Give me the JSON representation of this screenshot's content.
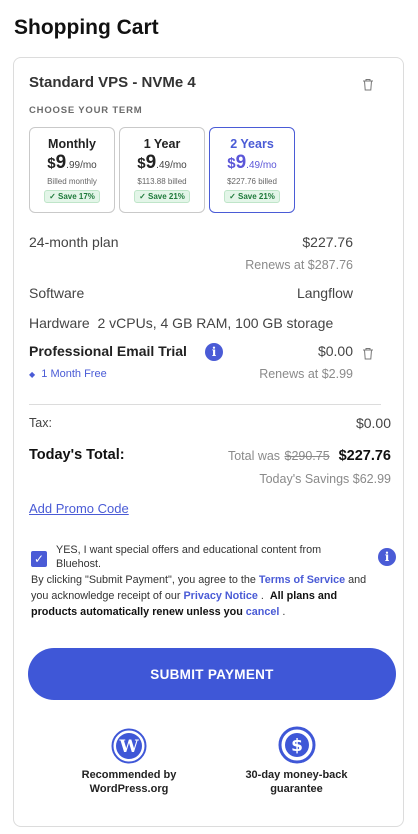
{
  "page_title": "Shopping Cart",
  "product": {
    "name": "Standard VPS - NVMe 4"
  },
  "term": {
    "label": "CHOOSE YOUR TERM",
    "options": [
      {
        "name": "Monthly",
        "currency": "$",
        "whole": "9",
        "fraction": ".99/mo",
        "billed": "Billed monthly",
        "save": "Save 17%",
        "selected": false
      },
      {
        "name": "1 Year",
        "currency": "$",
        "whole": "9",
        "fraction": ".49/mo",
        "billed": "$113.88 billed",
        "save": "Save 21%",
        "selected": false
      },
      {
        "name": "2 Years",
        "currency": "$",
        "whole": "9",
        "fraction": ".49/mo",
        "billed": "$227.76 billed",
        "save": "Save 21%",
        "selected": true
      }
    ]
  },
  "plan": {
    "label": "24-month plan",
    "price": "$227.76",
    "renews": "Renews at $287.76"
  },
  "software": {
    "label": "Software",
    "value": "Langflow"
  },
  "hardware": {
    "label": "Hardware",
    "value": "2 vCPUs, 4 GB RAM, 100 GB storage"
  },
  "email_trial": {
    "label": "Professional Email Trial",
    "price": "$0.00",
    "free_label": "1 Month Free",
    "renews": "Renews at $2.99"
  },
  "tax": {
    "label": "Tax:",
    "value": "$0.00"
  },
  "total": {
    "label": "Today's Total:",
    "was_prefix": "Total was",
    "was_value": "$290.75",
    "value": "$227.76",
    "savings": "Today's Savings $62.99"
  },
  "promo": {
    "label": "Add Promo Code"
  },
  "consent": {
    "checked": true,
    "text": "YES, I want special offers and educational content from Bluehost."
  },
  "legal": {
    "part1": "By clicking \"Submit Payment\", you agree to the",
    "terms_link": "Terms of Service",
    "part2": "and you acknowledge receipt of our",
    "privacy_link": "Privacy Notice",
    "part3": ".",
    "bold1": "All plans and products automatically renew unless you",
    "cancel_link": "cancel",
    "part4": "."
  },
  "submit": {
    "label": "SUBMIT PAYMENT"
  },
  "badges": [
    {
      "icon": "wordpress-icon",
      "text": "Recommended by WordPress.org"
    },
    {
      "icon": "money-back-icon",
      "text": "30-day money-back guarantee"
    }
  ],
  "colors": {
    "accent": "#3f57d7",
    "save_bg": "#e3f5e8",
    "save_text": "#1e7a3a"
  }
}
